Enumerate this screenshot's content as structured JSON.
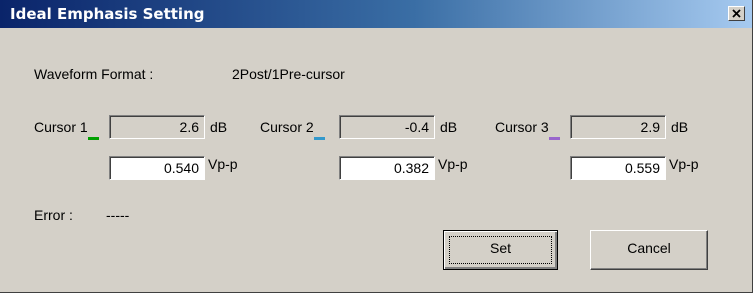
{
  "window": {
    "title": "Ideal Emphasis Setting",
    "close_icon": "close-icon"
  },
  "waveform": {
    "label": "Waveform Format :",
    "value": "2Post/1Pre-cursor"
  },
  "cursors": [
    {
      "label_prefix": "Cursor ",
      "number": "1",
      "db": "2.6",
      "db_unit": "dB",
      "vpp": "0.540",
      "vpp_unit": "Vp-p",
      "color": "#00a000"
    },
    {
      "label_prefix": "Cursor ",
      "number": "2",
      "db": "-0.4",
      "db_unit": "dB",
      "vpp": "0.382",
      "vpp_unit": "Vp-p",
      "color": "#3399cc"
    },
    {
      "label_prefix": "Cursor ",
      "number": "3",
      "db": "2.9",
      "db_unit": "dB",
      "vpp": "0.559",
      "vpp_unit": "Vp-p",
      "color": "#9966cc"
    }
  ],
  "error": {
    "label": "Error :",
    "value": "-----"
  },
  "buttons": {
    "set_label": "Set",
    "cancel_label": "Cancel"
  }
}
